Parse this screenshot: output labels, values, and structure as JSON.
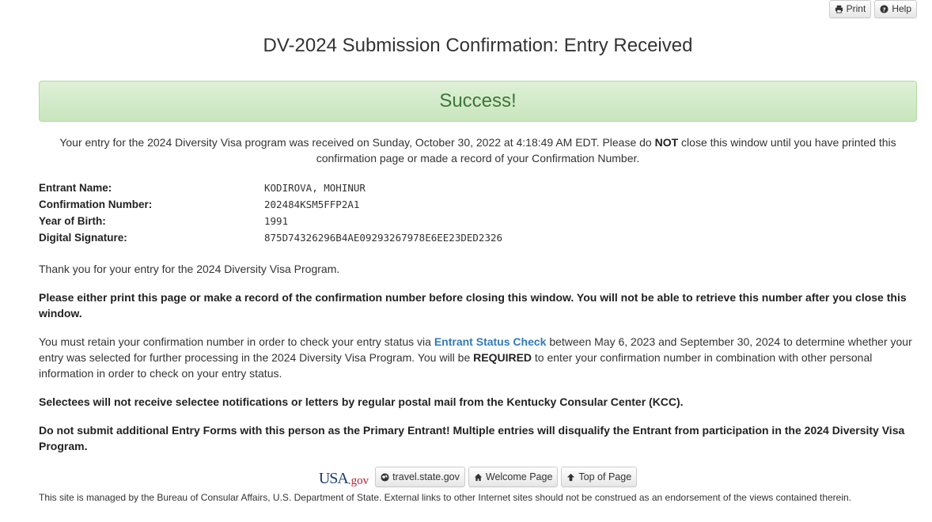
{
  "toolbar": {
    "print_label": "Print",
    "help_label": "Help"
  },
  "page_title": "DV-2024 Submission Confirmation: Entry Received",
  "alert": {
    "text": "Success!"
  },
  "intro": {
    "part1": "Your entry for the 2024 Diversity Visa program was received on Sunday, October 30, 2022 at 4:18:49 AM EDT. Please do ",
    "emphasis": "NOT",
    "part2": " close this window until you have printed this confirmation page or made a record of your Confirmation Number."
  },
  "fields": [
    {
      "label": "Entrant Name:",
      "value": "KODIROVA, MOHINUR"
    },
    {
      "label": "Confirmation Number:",
      "value": "202484KSM5FFP2A1"
    },
    {
      "label": "Year of Birth:",
      "value": "1991"
    },
    {
      "label": "Digital Signature:",
      "value": "875D74326296B4AE09293267978E6EE23DED2326"
    }
  ],
  "thanks": "Thank you for your entry for the 2024 Diversity Visa Program.",
  "print_warning": "Please either print this page or make a record of the confirmation number before closing this window. You will not be able to retrieve this number after you close this window.",
  "retain": {
    "part1": "You must retain your confirmation number in order to check your entry status via ",
    "link": "Entrant Status Check",
    "part2": " between May 6, 2023 and September 30, 2024 to determine whether your entry was selected for further processing in the 2024 Diversity Visa Program. You will be ",
    "emphasis": "REQUIRED",
    "part3": " to enter your confirmation number in combination with other personal information in order to check on your entry status."
  },
  "selectees": "Selectees will not receive selectee notifications or letters by regular postal mail from the Kentucky Consular Center (KCC).",
  "multiple": "Do not submit additional Entry Forms with this person as the Primary Entrant! Multiple entries will disqualify the Entrant from participation in the 2024 Diversity Visa Program.",
  "footer": {
    "logo_usa": "USA",
    "logo_gov": ".gov",
    "travel_label": "travel.state.gov",
    "welcome_label": "Welcome Page",
    "top_label": "Top of Page",
    "disclaimer": "This site is managed by the Bureau of Consular Affairs, U.S. Department of State. External links to other Internet sites should not be construed as an endorsement of the views contained therein."
  },
  "colors": {
    "success_text": "#3c763d",
    "link": "#337ab7"
  }
}
